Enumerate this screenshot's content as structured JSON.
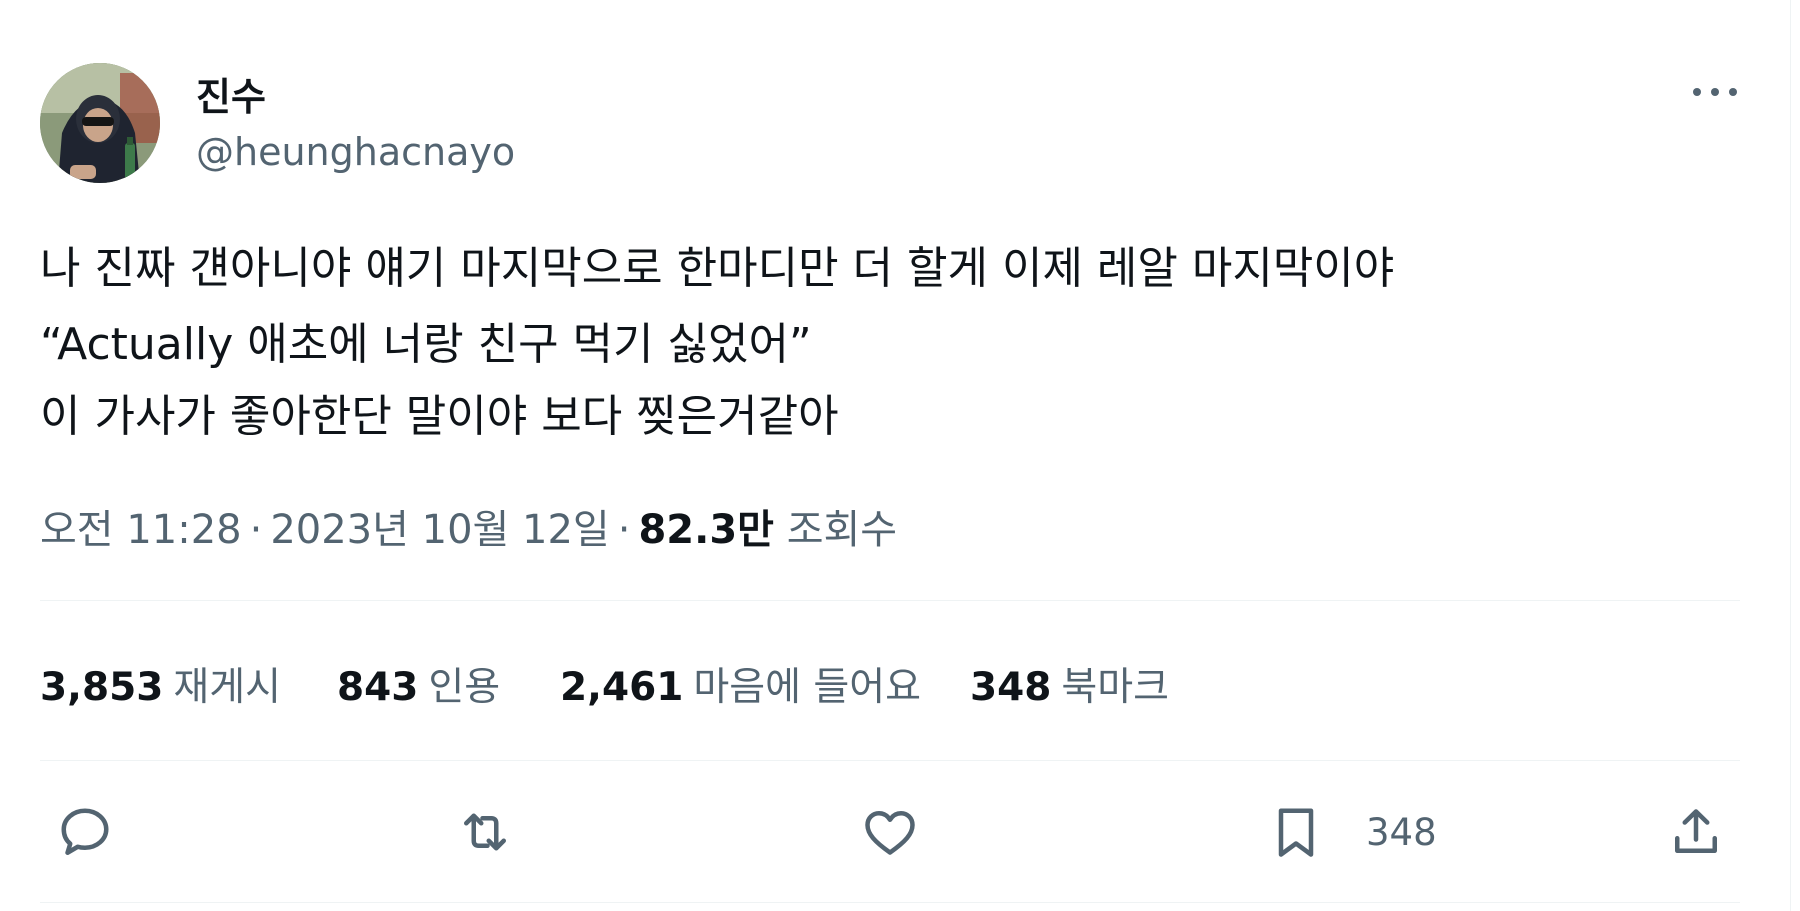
{
  "author": {
    "display_name": "진수",
    "handle": "@heunghacnayo"
  },
  "tweet": {
    "lines": [
      "나 진짜 걘아니야 얘기 마지막으로 한마디만 더 할게 이제 레알 마지막이야",
      "“Actually 애초에 너랑 친구 먹기 싫었어”",
      "이 가사가 좋아한단 말이야 보다 찢은거같아"
    ]
  },
  "meta": {
    "time": "오전 11:28",
    "date": "2023년 10월 12일",
    "separator": "·",
    "views_count": "82.3만",
    "views_label": "조회수"
  },
  "stats": {
    "retweets": {
      "count": "3,853",
      "label": "재게시"
    },
    "quotes": {
      "count": "843",
      "label": "인용"
    },
    "likes": {
      "count": "2,461",
      "label": "마음에 들어요"
    },
    "bookmarks": {
      "count": "348",
      "label": "북마크"
    }
  },
  "actions": {
    "bookmark_count": "348"
  },
  "icons": {
    "reply": "reply-icon",
    "retweet": "retweet-icon",
    "like": "heart-icon",
    "bookmark": "bookmark-icon",
    "share": "share-icon",
    "more": "more-icon"
  },
  "colors": {
    "text": "#0f1419",
    "secondary": "#536471",
    "divider": "#eff3f4"
  }
}
